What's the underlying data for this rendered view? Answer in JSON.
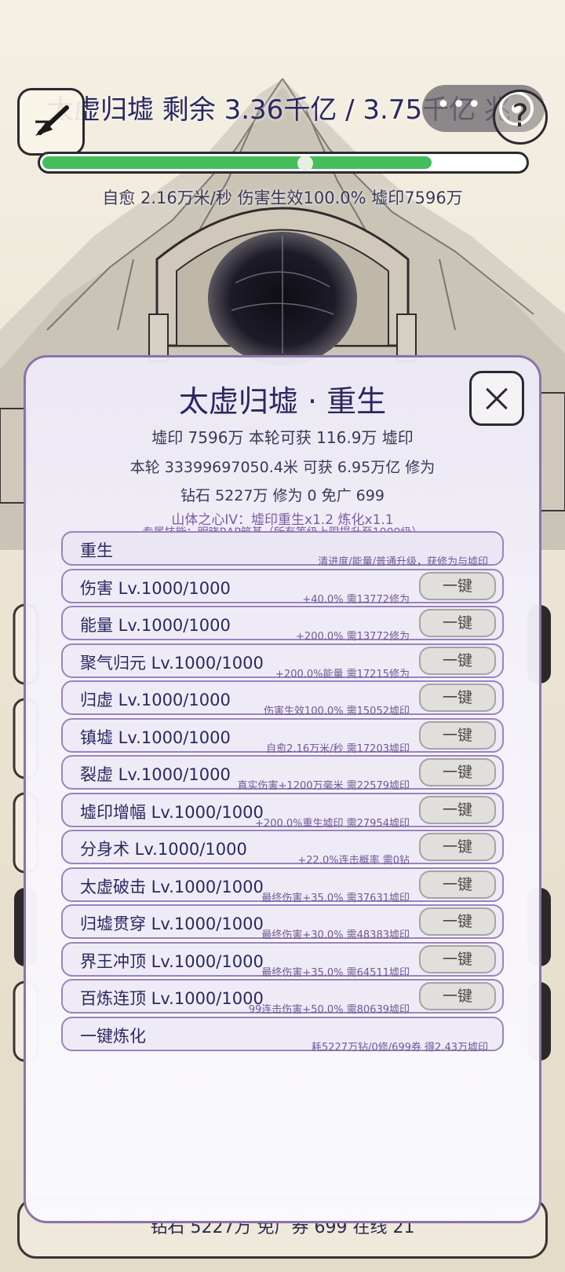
{
  "hud": {
    "boss_line": "太虚归墟  剩余 3.36千亿 / 3.75千亿 兆",
    "help_label": "?",
    "hp_fraction": 0.897,
    "stats_line": "自愈 2.16万米/秒  伤害生效100.0%  墟印7596万"
  },
  "bottom_bar": {
    "text": "钻石 5227万   免广券 699   在线 21"
  },
  "modal": {
    "title": "太虚归墟 · 重生",
    "info_1": "墟印 7596万   本轮可获 116.9万 墟印",
    "info_2": "本轮 33399697050.4米  可获 6.95万亿 修为",
    "info_3": "钻石 5227万  修为 0  免广 699",
    "info_4": "山体之心IV：墟印重生x1.2  炼化x1.1",
    "info_5": "专属技能：明晓RAP筑基（所有等级上限提升至1000级）",
    "one_key_label": "一键",
    "rows": [
      {
        "name": "重生",
        "desc": "清进度/能量/普通升级，获修为与墟印",
        "button": false
      },
      {
        "name": "伤害 Lv.1000/1000",
        "desc": "+40.0%  需13772修为",
        "button": true
      },
      {
        "name": "能量 Lv.1000/1000",
        "desc": "+200.0%  需13772修为",
        "button": true
      },
      {
        "name": "聚气归元 Lv.1000/1000",
        "desc": "+200.0%能量  需17215修为",
        "button": true
      },
      {
        "name": "归虚 Lv.1000/1000",
        "desc": "伤害生效100.0%  需15052墟印",
        "button": true
      },
      {
        "name": "镇墟 Lv.1000/1000",
        "desc": "自愈2.16万米/秒  需17203墟印",
        "button": true
      },
      {
        "name": "裂虚 Lv.1000/1000",
        "desc": "真实伤害+1200万毫米  需22579墟印",
        "button": true
      },
      {
        "name": "墟印增幅 Lv.1000/1000",
        "desc": "+200.0%重生墟印  需27954墟印",
        "button": true
      },
      {
        "name": "分身术 Lv.1000/1000",
        "desc": "+22.0%连击概率  需0钻",
        "button": true
      },
      {
        "name": "太虚破击 Lv.1000/1000",
        "desc": "最终伤害+35.0%  需37631墟印",
        "button": true
      },
      {
        "name": "归墟贯穿 Lv.1000/1000",
        "desc": "最终伤害+30.0%  需48383墟印",
        "button": true
      },
      {
        "name": "界王冲顶 Lv.1000/1000",
        "desc": "最终伤害+35.0%  需64511墟印",
        "button": true
      },
      {
        "name": "百炼连顶 Lv.1000/1000",
        "desc": "99连击伤害+50.0%  需80639墟印",
        "button": true
      },
      {
        "name": "一键炼化",
        "desc": "耗5227万钻/0修/699券  得2.43万墟印",
        "button": false
      }
    ]
  },
  "colors": {
    "accent": "#2b2860",
    "modal_border": "#8c73ab",
    "hp_green": "#44bd5c",
    "row_desc": "#6f5a96"
  },
  "icons": {
    "back": "arrow-back-icon",
    "menu": "more-dots-icon",
    "target": "target-ring-icon",
    "help": "help-icon",
    "close": "close-icon"
  }
}
